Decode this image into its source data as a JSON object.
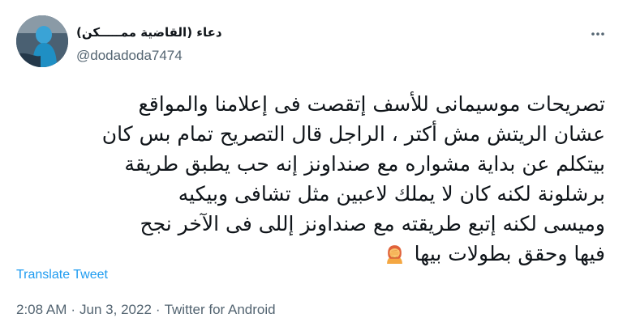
{
  "author": {
    "display_name": "دعاء (القاضية ممـــــكن)",
    "handle": "@dodadoda7474"
  },
  "tweet": {
    "text": "تصريحات موسيمانى للأسف إتقصت فى إعلامنا والمواقع\nعشان الريتش مش أكتر ، الراجل قال التصريح تمام بس كان\nبيتكلم عن بداية مشواره مع صنداونز إنه حب يطبق طريقة\nبرشلونة لكنه كان لا يملك لاعبين مثل تشافى وبيكيه\nوميسى لكنه إتبع طريقته مع صنداونز إللى فى الآخر نجح\nفيها وحقق بطولات بيها",
    "emoji": "facepalm-woman"
  },
  "translate_label": "Translate Tweet",
  "meta": {
    "time": "2:08 AM",
    "separator": "·",
    "date": "Jun 3, 2022",
    "client": "Twitter for Android"
  },
  "icons": {
    "more": "more-dots-icon"
  },
  "colors": {
    "link": "#1d9bf0",
    "secondary_text": "#536471",
    "primary_text": "#0f1419"
  }
}
